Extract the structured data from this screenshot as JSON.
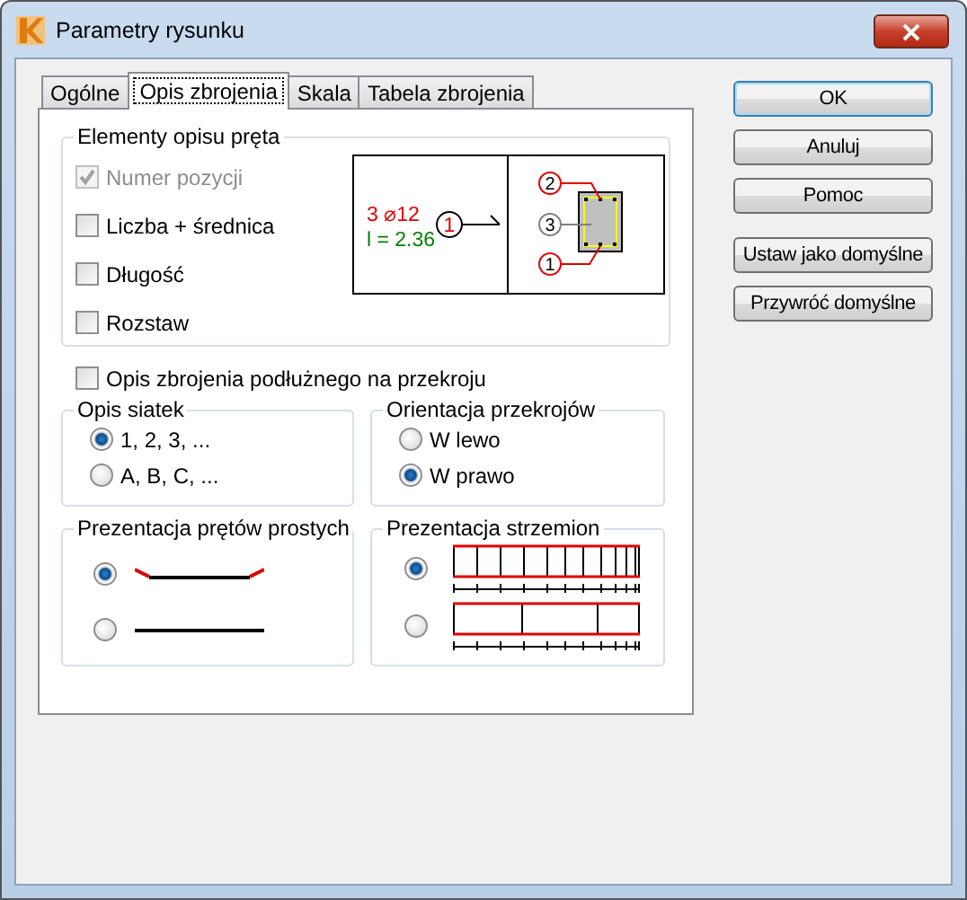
{
  "window": {
    "title": "Parametry rysunku"
  },
  "tabs": [
    {
      "label": "Ogólne",
      "selected": false
    },
    {
      "label": "Opis zbrojenia",
      "selected": true
    },
    {
      "label": "Skala",
      "selected": false
    },
    {
      "label": "Tabela zbrojenia",
      "selected": false
    }
  ],
  "rod_description": {
    "title": "Elementy opisu pręta",
    "options": [
      {
        "label": "Numer pozycji",
        "checked": true,
        "disabled": true
      },
      {
        "label": "Liczba + średnica",
        "checked": false,
        "disabled": false
      },
      {
        "label": "Długość",
        "checked": false,
        "disabled": false
      },
      {
        "label": "Rozstaw",
        "checked": false,
        "disabled": false
      }
    ],
    "diagram": {
      "count_diameter": "3 ⌀12",
      "length": "l = 2.36",
      "left_mark": "1",
      "section_marks": [
        "2",
        "3",
        "1"
      ]
    }
  },
  "section_description": {
    "label": "Opis zbrojenia podłużnego na przekroju",
    "checked": false
  },
  "mesh_description": {
    "title": "Opis siatek",
    "options": [
      {
        "label": "1, 2, 3, ...",
        "selected": true
      },
      {
        "label": "A, B, C, ...",
        "selected": false
      }
    ]
  },
  "section_orientation": {
    "title": "Orientacja przekrojów",
    "options": [
      {
        "label": "W lewo",
        "selected": false
      },
      {
        "label": "W prawo",
        "selected": true
      }
    ]
  },
  "straight_bars": {
    "title": "Prezentacja prętów prostych",
    "options": [
      {
        "kind": "hooked",
        "selected": true
      },
      {
        "kind": "plain",
        "selected": false
      }
    ]
  },
  "stirrups": {
    "title": "Prezentacja strzemion",
    "options": [
      {
        "kind": "dense-ends",
        "selected": true
      },
      {
        "kind": "uniform",
        "selected": false
      }
    ]
  },
  "buttons": [
    {
      "label": "OK",
      "default": true
    },
    {
      "label": "Anuluj",
      "default": false
    },
    {
      "label": "Pomoc",
      "default": false
    },
    {
      "label": "Ustaw jako domyślne",
      "default": false
    },
    {
      "label": "Przywróć domyślne",
      "default": false
    }
  ]
}
